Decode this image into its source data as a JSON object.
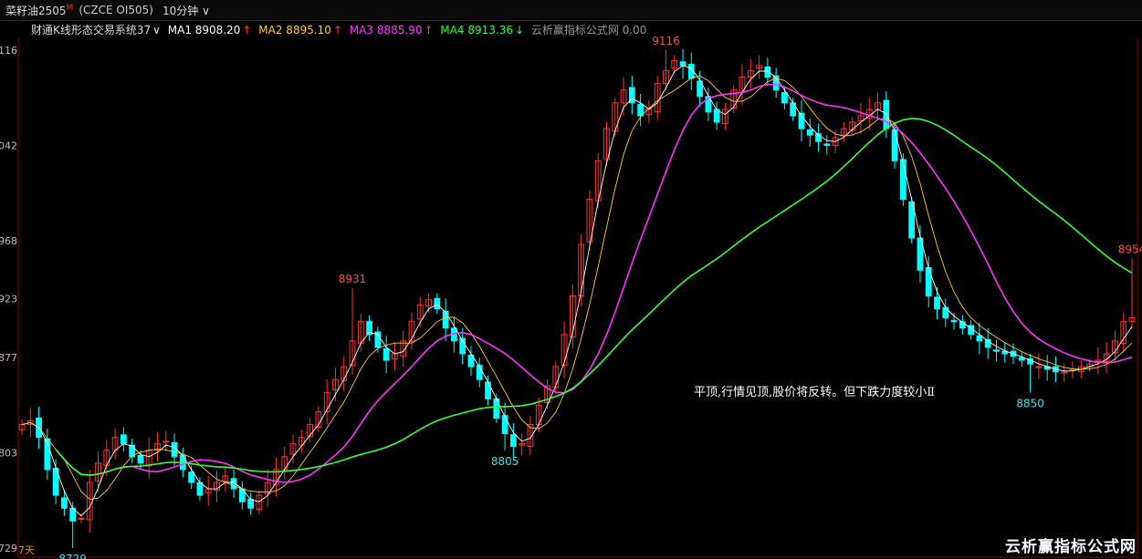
{
  "topbar": {
    "title": "菜籽油2505",
    "title_mark": "M",
    "code": "(CZCE OI505)",
    "period": "10分钟",
    "period_arrow": "∨"
  },
  "legend": {
    "system": "财通K线形态交易系统37",
    "system_arrow": "∨",
    "ma1": "MA1 8908.20",
    "ma1_arrow": "↑",
    "ma2": "MA2 8895.10",
    "ma2_arrow": "↑",
    "ma3": "MA3 8885.90",
    "ma3_arrow": "↑",
    "ma4": "MA4 8913.36",
    "ma4_arrow": "↓",
    "source": "云析赢指标公式网 0.00"
  },
  "watermark": "云析赢指标公式网",
  "colors": {
    "up": "#ff3333",
    "down": "#00ffff",
    "ma1": "#ffffff",
    "ma2": "#ffcc33",
    "ma3": "#ff33ff",
    "ma4": "#33ff33"
  },
  "chart_data": {
    "type": "candlestick",
    "y_tick_labels": [
      "116",
      "042",
      "968",
      "923",
      "877",
      "803",
      "729"
    ],
    "ylim": [
      8726,
      9120
    ],
    "y_ticks": [
      9116,
      9042,
      8968,
      8923,
      8877,
      8803,
      8729
    ],
    "annotations": [
      {
        "text": "9116",
        "value": 9116,
        "candle": 76,
        "kind": "high"
      },
      {
        "text": "8931",
        "value": 8931,
        "candle": 39,
        "kind": "high"
      },
      {
        "text": "8805",
        "value": 8805,
        "candle": 57,
        "kind": "low"
      },
      {
        "text": "8729",
        "value": 8729,
        "candle": 6,
        "kind": "low"
      },
      {
        "text": "8850",
        "value": 8850,
        "candle": 119,
        "kind": "low"
      },
      {
        "text": "8954",
        "value": 8954,
        "candle": 131,
        "kind": "high"
      }
    ],
    "note": "平顶,行情见顶,股价将反转。但下跌力度较小Ⅱ",
    "bottom_label": "7天",
    "closes": [
      8825,
      8828,
      8815,
      8790,
      8770,
      8760,
      8750,
      8752,
      8780,
      8795,
      8805,
      8815,
      8810,
      8800,
      8795,
      8805,
      8810,
      8812,
      8800,
      8790,
      8780,
      8770,
      8775,
      8780,
      8785,
      8775,
      8765,
      8760,
      8770,
      8780,
      8790,
      8800,
      8810,
      8815,
      8825,
      8835,
      8850,
      8860,
      8870,
      8890,
      8905,
      8895,
      8885,
      8875,
      8880,
      8890,
      8905,
      8918,
      8922,
      8915,
      8900,
      8890,
      8880,
      8870,
      8860,
      8845,
      8830,
      8818,
      8808,
      8810,
      8825,
      8840,
      8855,
      8870,
      8895,
      8925,
      8965,
      9000,
      9030,
      9055,
      9075,
      9085,
      9075,
      9065,
      9070,
      9090,
      9100,
      9108,
      9104,
      9094,
      9080,
      9068,
      9060,
      9070,
      9085,
      9095,
      9100,
      9104,
      9095,
      9085,
      9075,
      9065,
      9055,
      9050,
      9045,
      9042,
      9048,
      9055,
      9060,
      9065,
      9070,
      9075,
      9055,
      9030,
      9000,
      8970,
      8945,
      8925,
      8915,
      8908,
      8905,
      8900,
      8895,
      8890,
      8885,
      8882,
      8880,
      8878,
      8875,
      8872,
      8870,
      8868,
      8866,
      8866,
      8868,
      8870,
      8872,
      8875,
      8880,
      8890,
      8905,
      8908
    ]
  }
}
